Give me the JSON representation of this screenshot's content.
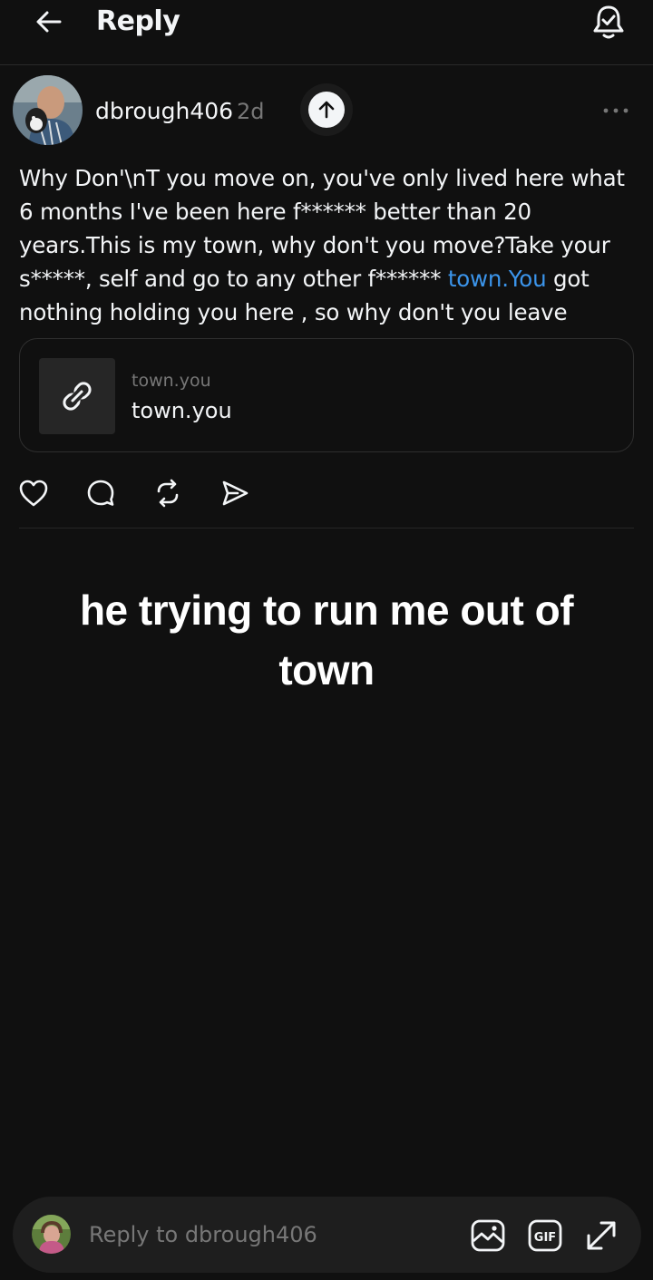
{
  "header": {
    "title": "Reply",
    "back_icon": "arrow-left-icon",
    "notify_icon": "bell-check-icon"
  },
  "post": {
    "username": "dbrough406",
    "timestamp": "2d",
    "body_before_link": "Why Don'\\nT you move on, you've only lived here what 6 months I've been here f****** better than 20 years.This is my town, why don't you move?Take your s*****, self and go to any other f****** ",
    "body_link": "town.You",
    "body_after_link": " got nothing holding you here , so why don't you leave",
    "link_card": {
      "domain": "town.you",
      "title": "town.you"
    },
    "actions": [
      "heart-icon",
      "comment-icon",
      "repost-icon",
      "share-icon"
    ]
  },
  "caption": "he trying to run me out of town",
  "reply_bar": {
    "placeholder": "Reply to dbrough406",
    "icons": [
      "image-icon",
      "gif-icon",
      "expand-icon"
    ]
  },
  "colors": {
    "background": "#101010",
    "text": "#f3f5f7",
    "muted": "#777777",
    "link": "#3b94ea"
  }
}
